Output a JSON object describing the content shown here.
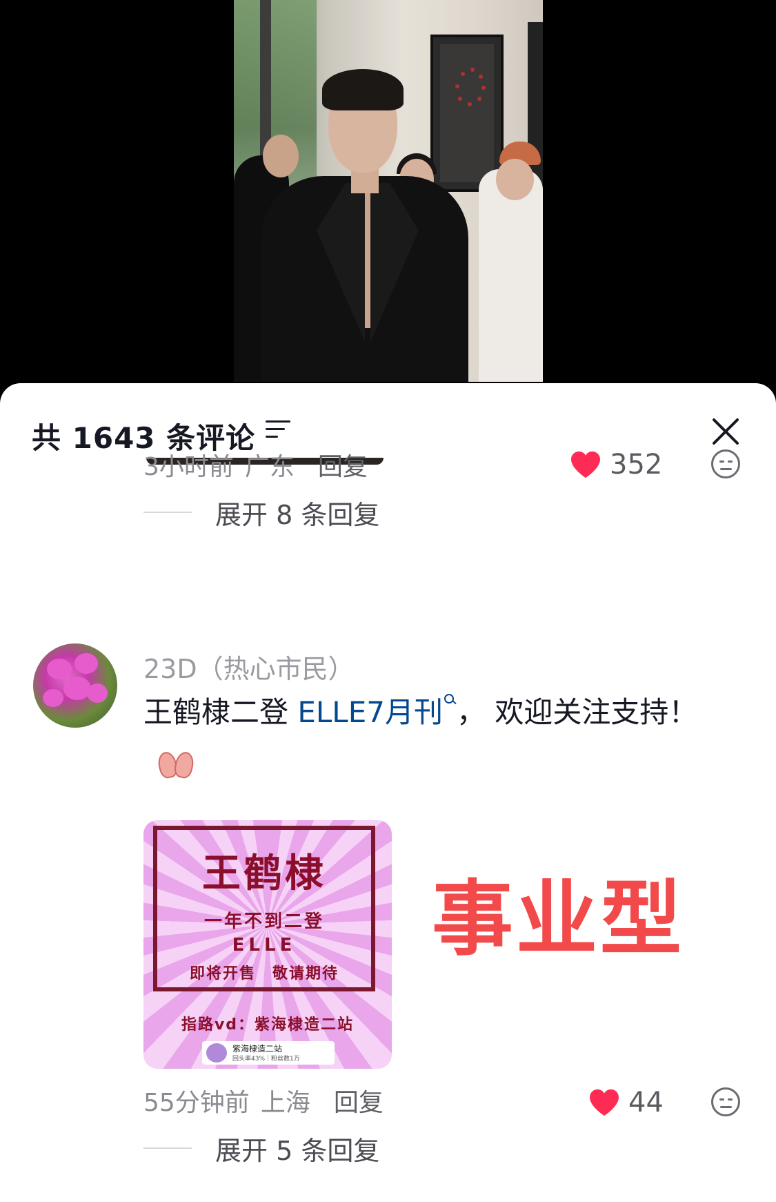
{
  "header": {
    "title": "共 1643 条评论"
  },
  "comments": [
    {
      "meta": {
        "time": "3小时前",
        "location": "广东",
        "reply_label": "回复"
      },
      "likes": "352",
      "expand_label": "展开 8 条回复"
    },
    {
      "username": "23D（热心市民）",
      "text_before_link": "王鹤棣二登 ",
      "link_text": "ELLE7月刊",
      "text_after_link": "， 欢迎关注支持！",
      "image": {
        "line1": "王鹤棣",
        "line2": "一年不到二登",
        "line3": "ELLE",
        "line4": "即将开售　敬请期待",
        "line5": "指路vd：紫海棣造二站",
        "badge_name": "紫海棣造二站",
        "badge_stats": "回头率43%｜粉丝数1万"
      },
      "overlay_text": "事业型",
      "meta": {
        "time": "55分钟前",
        "location": "上海",
        "reply_label": "回复"
      },
      "likes": "44",
      "expand_label": "展开 5 条回复"
    }
  ],
  "colors": {
    "heart": "#fe2c55",
    "link": "#04498d",
    "overlay": "#f24a4a"
  },
  "icons": [
    "filter-icon",
    "close-icon",
    "heart-icon",
    "dislike-icon",
    "search-icon",
    "pray-emoji-icon"
  ]
}
